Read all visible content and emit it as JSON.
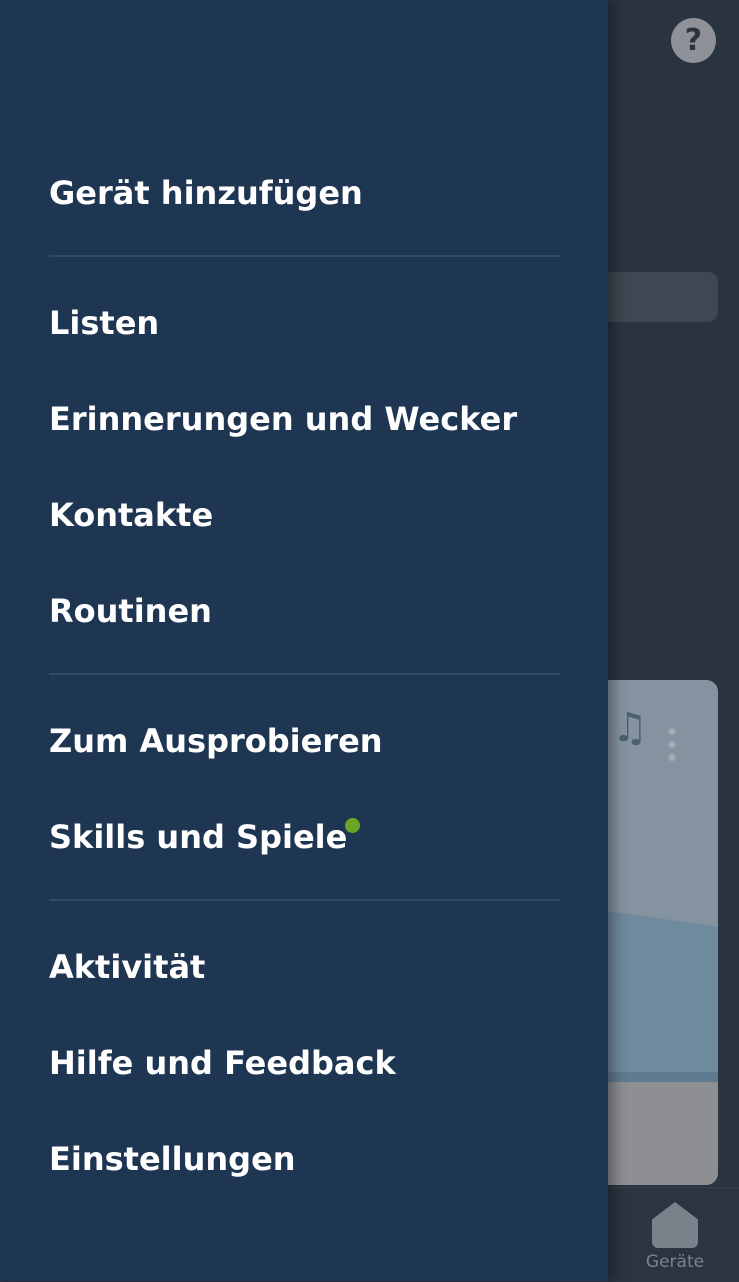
{
  "background": {
    "help_icon": "?",
    "music_icon": "♫",
    "bottom_nav": {
      "devices_label": "Geräte"
    }
  },
  "drawer": {
    "items": [
      {
        "label": "Gerät hinzufügen"
      },
      {
        "label": "Listen"
      },
      {
        "label": "Erinnerungen und Wecker"
      },
      {
        "label": "Kontakte"
      },
      {
        "label": "Routinen"
      },
      {
        "label": "Zum Ausprobieren"
      },
      {
        "label": "Skills und Spiele"
      },
      {
        "label": "Aktivität"
      },
      {
        "label": "Hilfe und Feedback"
      },
      {
        "label": "Einstellungen"
      }
    ],
    "new_indicator_color": "#6aa523"
  },
  "colors": {
    "drawer_bg": "#1f3652",
    "app_bg": "#2a3441",
    "text": "#ffffff"
  }
}
